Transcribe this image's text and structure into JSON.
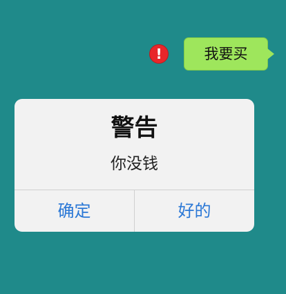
{
  "chat": {
    "message_text": "我要买",
    "error_icon": "!",
    "colors": {
      "background": "#1f8a8a",
      "bubble": "#9ee65c",
      "error": "#e8262a"
    }
  },
  "alert": {
    "title": "警告",
    "message": "你没钱",
    "buttons": {
      "confirm_label": "确定",
      "ok_label": "好的"
    },
    "colors": {
      "button_text": "#2b78d6"
    }
  }
}
